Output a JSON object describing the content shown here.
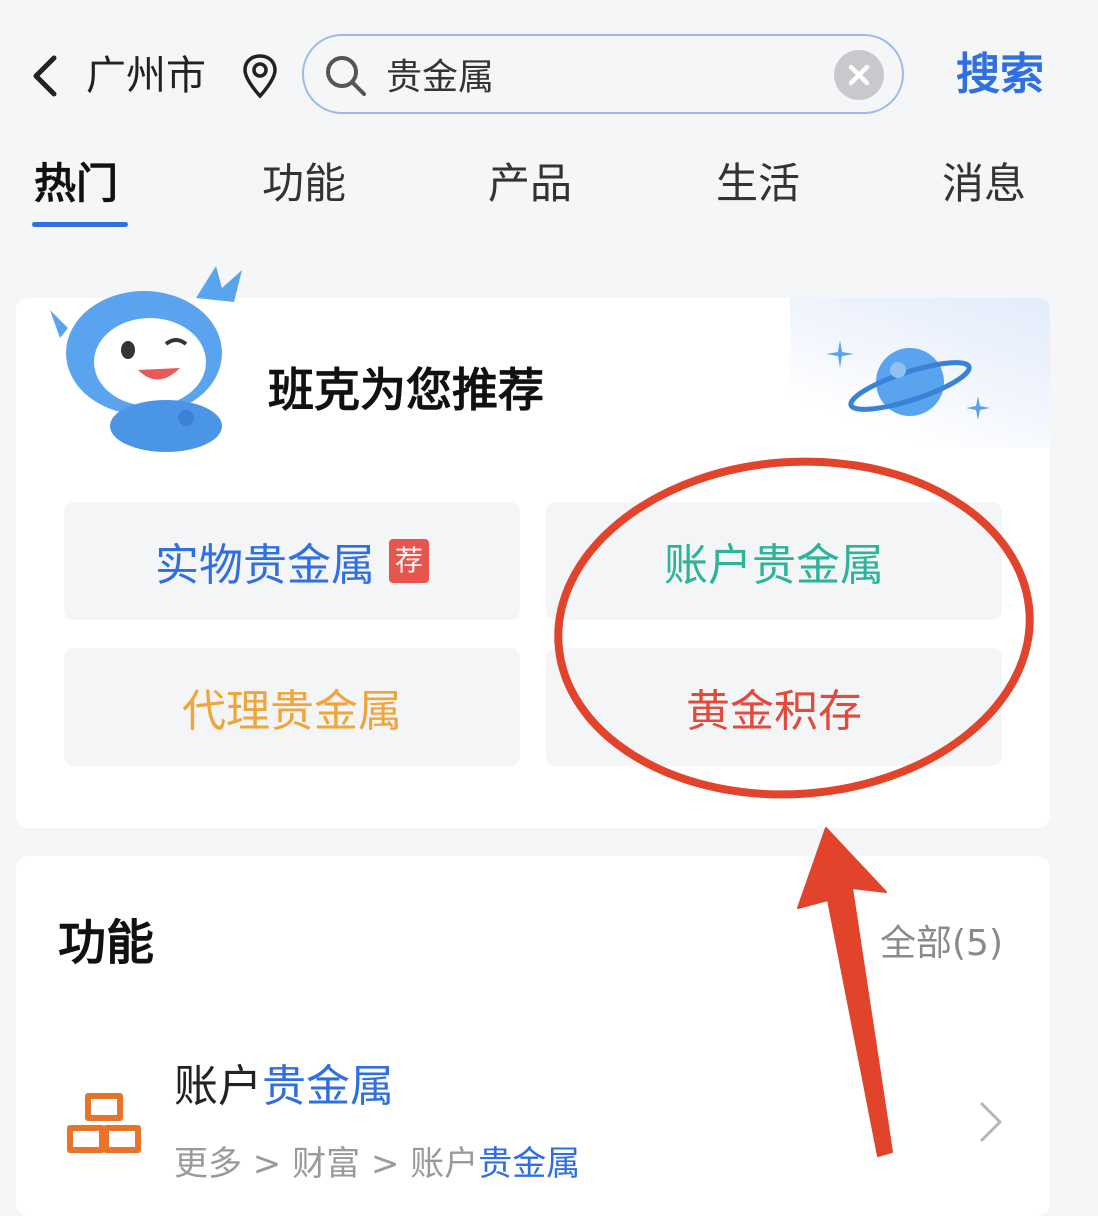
{
  "topbar": {
    "city": "广州市",
    "search_value": "贵金属",
    "search_button": "搜索"
  },
  "tabs": [
    {
      "label": "热门",
      "active": true
    },
    {
      "label": "功能"
    },
    {
      "label": "产品"
    },
    {
      "label": "生活"
    },
    {
      "label": "消息"
    }
  ],
  "recommend": {
    "title": "班克为您推荐",
    "options": [
      {
        "label": "实物贵金属",
        "color": "#2f6fe0",
        "badge": "荐"
      },
      {
        "label": "账户贵金属",
        "color": "#2db39a"
      },
      {
        "label": "代理贵金属",
        "color": "#f0a53a"
      },
      {
        "label": "黄金积存",
        "color": "#e24a3b"
      }
    ]
  },
  "functions": {
    "title": "功能",
    "all_label": "全部(5)",
    "items": [
      {
        "name_prefix": "账户",
        "name_highlight": "贵金属",
        "path_prefix": "更多 > 财富 > 账户",
        "path_highlight": "贵金属"
      }
    ]
  },
  "colors": {
    "accent": "#2f6fe0",
    "annotation": "#e2432b"
  }
}
